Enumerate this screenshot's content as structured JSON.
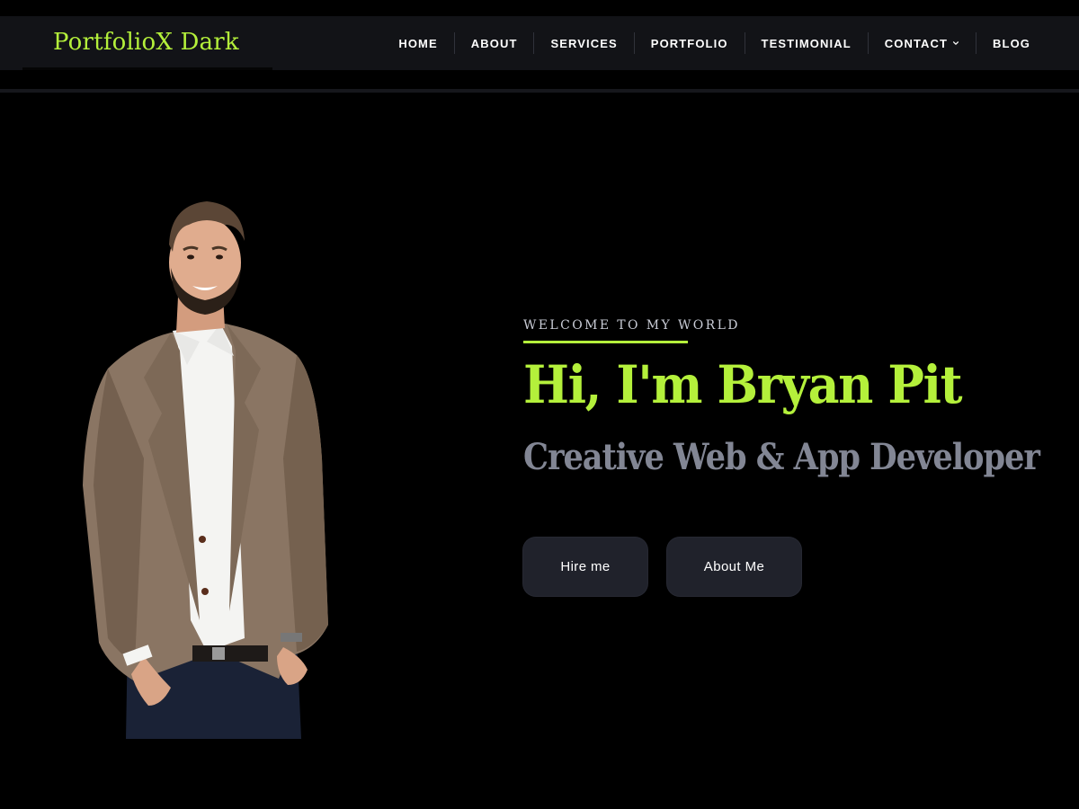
{
  "brand": {
    "name": "PortfolioX Dark"
  },
  "nav": {
    "items": [
      {
        "label": "HOME"
      },
      {
        "label": "ABOUT"
      },
      {
        "label": "SERVICES"
      },
      {
        "label": "PORTFOLIO"
      },
      {
        "label": "TESTIMONIAL"
      },
      {
        "label": "CONTACT",
        "has_dropdown": true
      },
      {
        "label": "BLOG"
      }
    ]
  },
  "hero": {
    "eyebrow": "WELCOME TO MY WORLD",
    "headline": "Hi, I'm Bryan Pit",
    "subheadline": "Creative Web & App Developer",
    "buttons": {
      "hire": "Hire me",
      "about": "About Me"
    },
    "photo_icon": "person-photo"
  },
  "colors": {
    "accent": "#b4f03b",
    "background": "#000000",
    "header_bg": "#121317",
    "button_bg": "#20222b",
    "subhead": "#828694"
  }
}
